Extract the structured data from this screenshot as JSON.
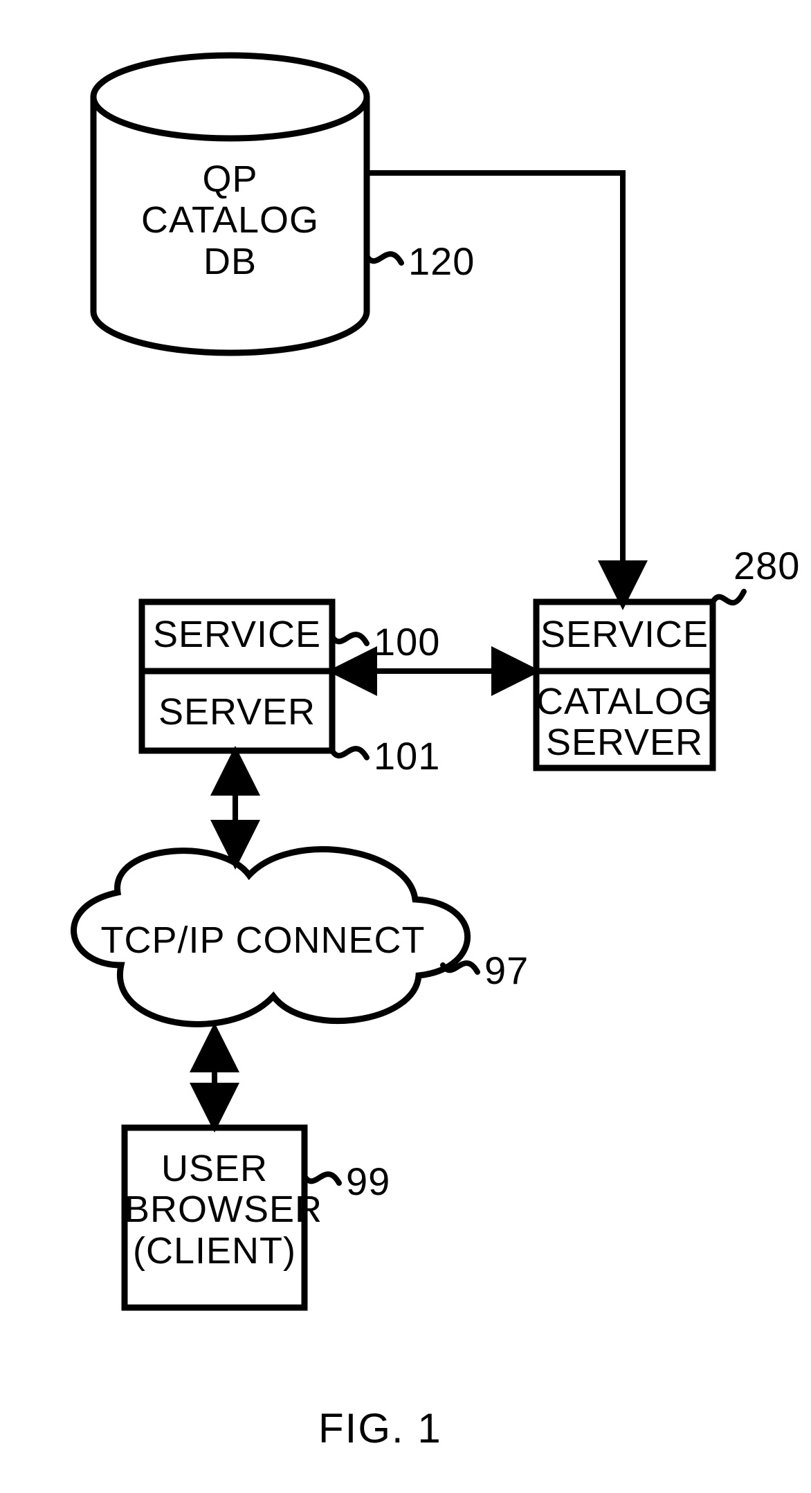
{
  "figure_caption": "FIG. 1",
  "nodes": {
    "db": {
      "line1": "QP",
      "line2": "CATALOG",
      "line3": "DB",
      "ref": "120"
    },
    "service_left": {
      "label": "SERVICE",
      "ref": "100"
    },
    "server_left": {
      "label": "SERVER",
      "ref": "101"
    },
    "service_right": {
      "label": "SERVICE"
    },
    "catalog_server_right": {
      "line1": "CATALOG",
      "line2": "SERVER",
      "ref": "280"
    },
    "cloud": {
      "label": "TCP/IP CONNECT",
      "ref": "97"
    },
    "client": {
      "line1": "USER",
      "line2": "BROWSER",
      "line3": "(CLIENT)",
      "ref": "99"
    }
  }
}
